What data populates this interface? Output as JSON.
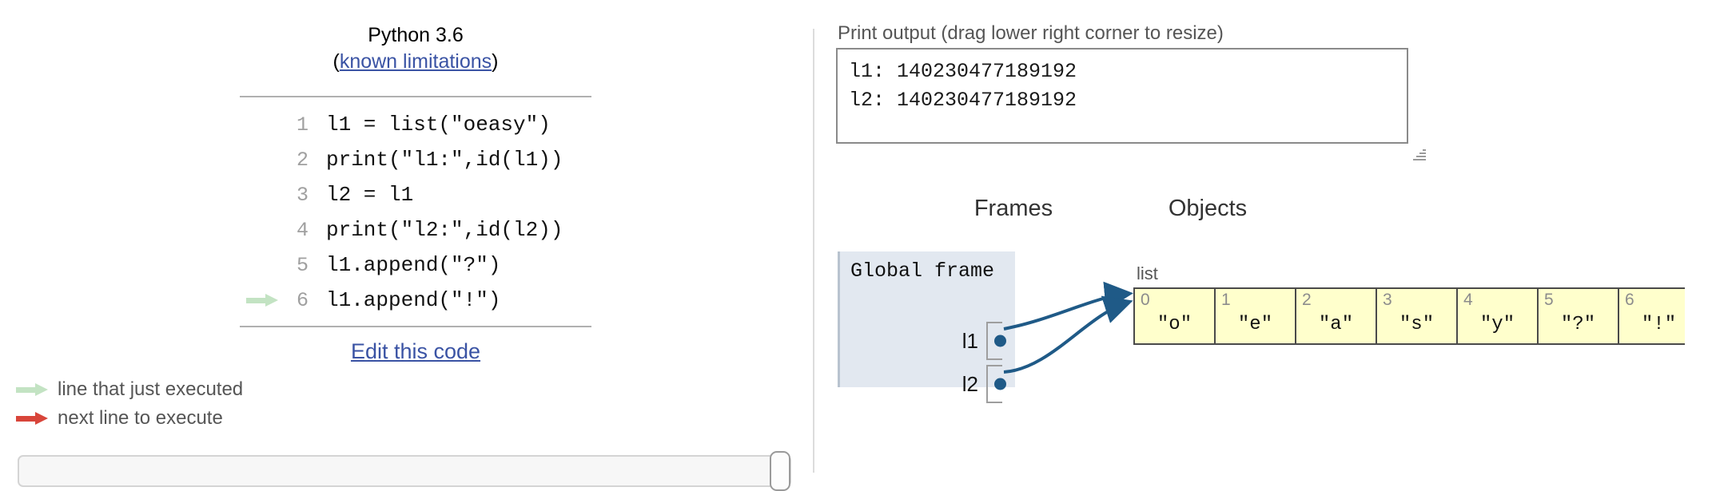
{
  "version": {
    "label": "Python 3.6",
    "limitations_prefix": "(",
    "limitations_link": "known limitations",
    "limitations_suffix": ")"
  },
  "code": {
    "lines": [
      {
        "number": "1",
        "text": "l1 = list(\"oeasy\")",
        "marker": ""
      },
      {
        "number": "2",
        "text": "print(\"l1:\",id(l1))",
        "marker": ""
      },
      {
        "number": "3",
        "text": "l2 = l1",
        "marker": ""
      },
      {
        "number": "4",
        "text": "print(\"l2:\",id(l2))",
        "marker": ""
      },
      {
        "number": "5",
        "text": "l1.append(\"?\")",
        "marker": ""
      },
      {
        "number": "6",
        "text": "l1.append(\"!\")",
        "marker": "just-executed"
      }
    ],
    "edit_link": "Edit this code"
  },
  "legend": {
    "items": [
      {
        "color": "#c3e3c3",
        "label": "line that just executed",
        "icon": "green-arrow-icon"
      },
      {
        "color": "#d8453a",
        "label": "next line to execute",
        "icon": "red-arrow-icon"
      }
    ]
  },
  "print_output": {
    "label": "Print output (drag lower right corner to resize)",
    "text": "l1: 140230477189192\nl2: 140230477189192",
    "resize_grip": "resize-grip-icon"
  },
  "diagram": {
    "frames_heading": "Frames",
    "objects_heading": "Objects",
    "frame": {
      "title": "Global frame",
      "variables": [
        {
          "name": "l1",
          "points_to": "list-object"
        },
        {
          "name": "l2",
          "points_to": "list-object"
        }
      ]
    },
    "objects": [
      {
        "type_label": "list",
        "cells": [
          {
            "index": "0",
            "value": "\"o\""
          },
          {
            "index": "1",
            "value": "\"e\""
          },
          {
            "index": "2",
            "value": "\"a\""
          },
          {
            "index": "3",
            "value": "\"s\""
          },
          {
            "index": "4",
            "value": "\"y\""
          },
          {
            "index": "5",
            "value": "\"?\""
          },
          {
            "index": "6",
            "value": "\"!\""
          }
        ]
      }
    ]
  },
  "colors": {
    "link": "#3a53a4",
    "frame_bg": "#e2e8f0",
    "object_bg": "#ffffcc",
    "pointer": "#1f5a87",
    "just_executed": "#c3e3c3",
    "next_line": "#d8453a"
  }
}
